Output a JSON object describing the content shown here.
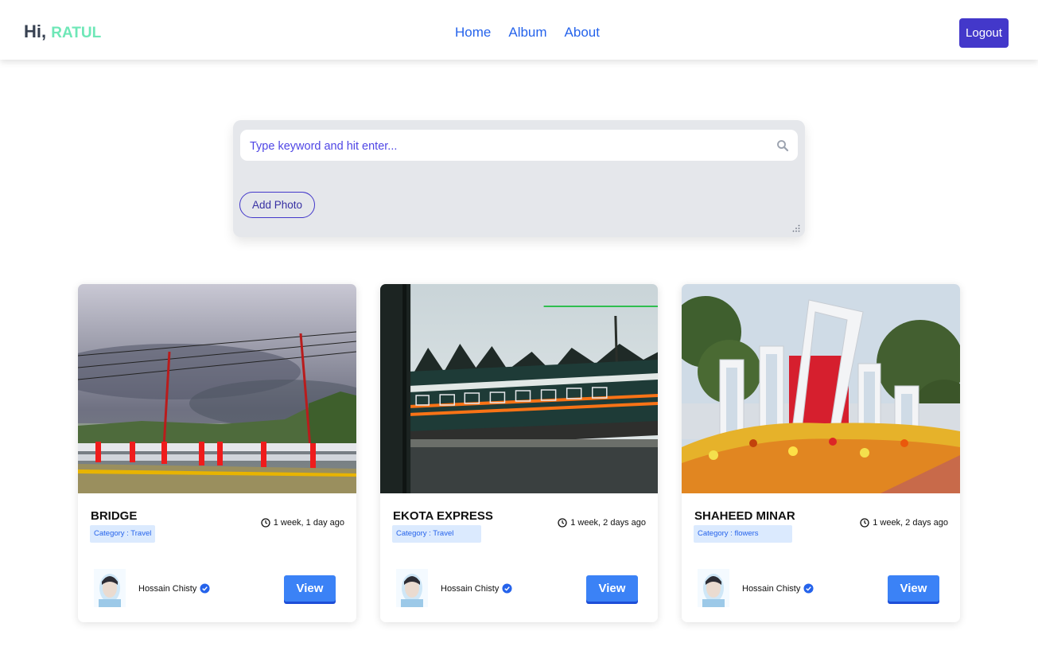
{
  "header": {
    "greeting": "Hi,",
    "username": "RATUL",
    "nav": [
      "Home",
      "Album",
      "About"
    ],
    "logout": "Logout"
  },
  "search": {
    "placeholder": "Type keyword and hit enter...",
    "add_photo": "Add Photo"
  },
  "cards": [
    {
      "title": "BRIDGE",
      "category": "Category : Travel",
      "time": "1 week, 1 day ago",
      "author": "Hossain Chisty",
      "view": "View"
    },
    {
      "title": "EKOTA EXPRESS",
      "category": "Category : Travel",
      "time": "1 week, 2 days ago",
      "author": "Hossain Chisty",
      "view": "View"
    },
    {
      "title": "SHAHEED MINAR",
      "category": "Category : flowers",
      "time": "1 week, 2 days ago",
      "author": "Hossain Chisty",
      "view": "View"
    }
  ],
  "colors": {
    "brand": "#4338ca",
    "link": "#2563eb",
    "view_button": "#3b82f6",
    "username": "#6ee7b7",
    "category_bg": "#dbeafe"
  }
}
